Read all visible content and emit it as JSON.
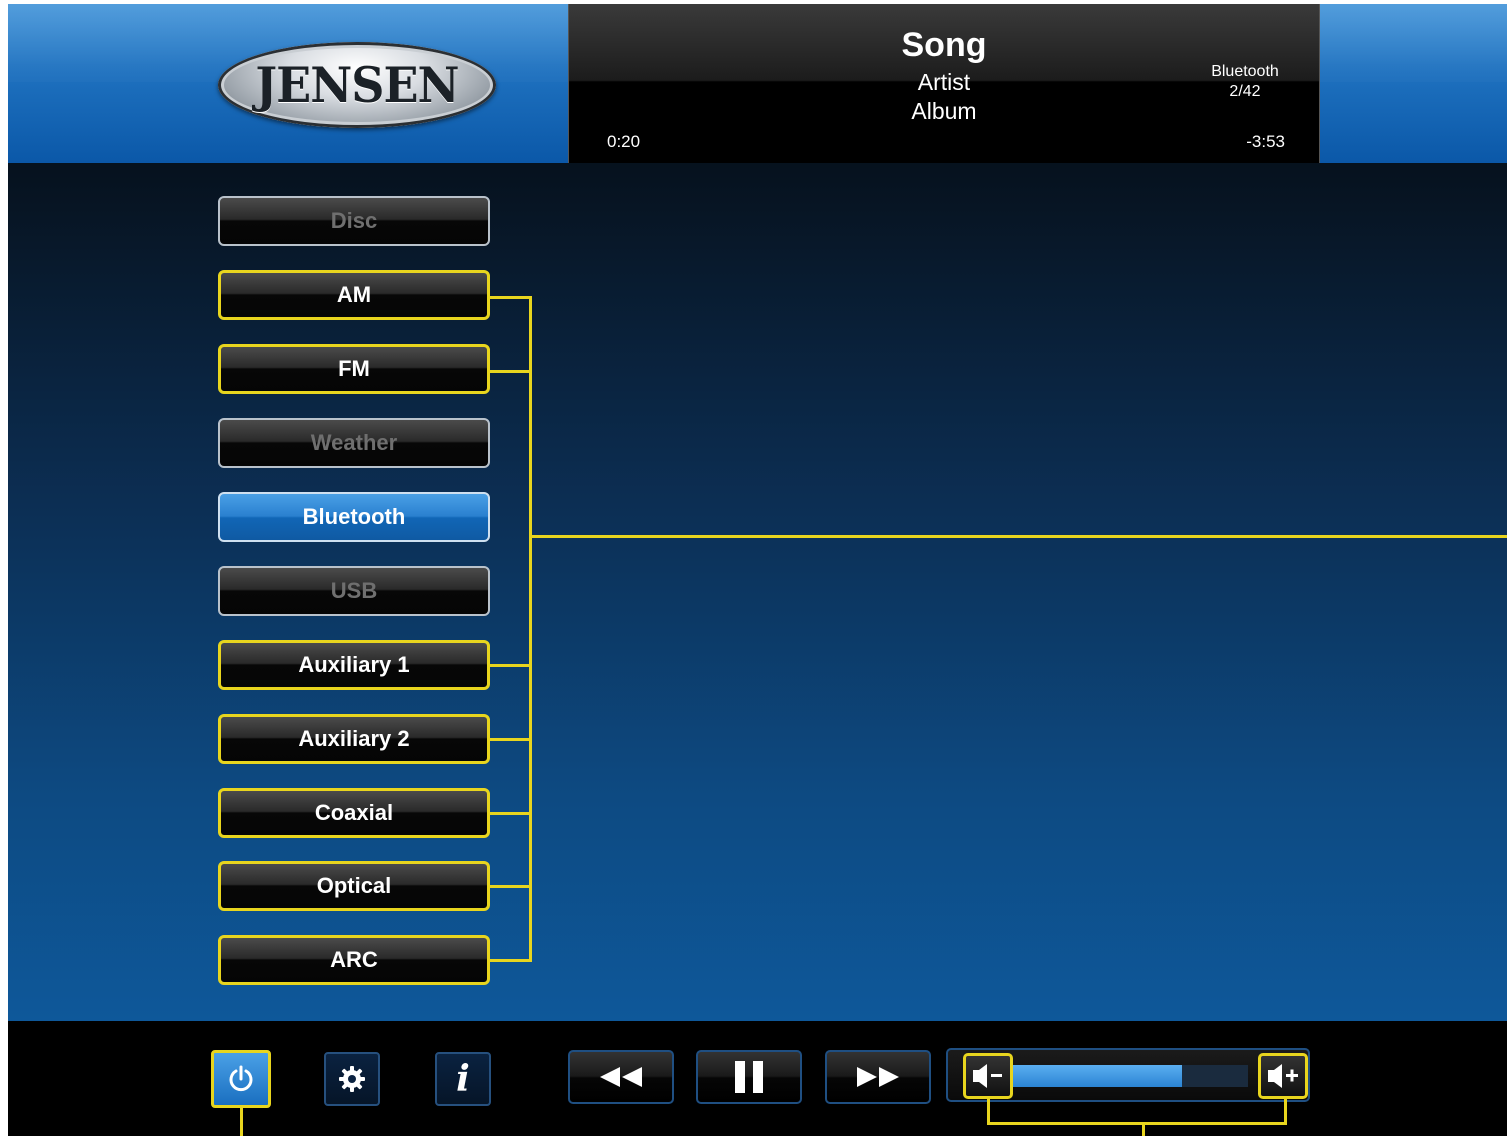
{
  "brand": {
    "logo_text": "JENSEN"
  },
  "now_playing": {
    "song": "Song",
    "artist": "Artist",
    "album": "Album",
    "source": "Bluetooth",
    "track": "2/42",
    "elapsed": "0:20",
    "remaining": "-3:53"
  },
  "sources": [
    {
      "label": "Disc",
      "state": "disabled"
    },
    {
      "label": "AM",
      "state": "highlighted"
    },
    {
      "label": "FM",
      "state": "highlighted"
    },
    {
      "label": "Weather",
      "state": "disabled"
    },
    {
      "label": "Bluetooth",
      "state": "active"
    },
    {
      "label": "USB",
      "state": "disabled"
    },
    {
      "label": "Auxiliary 1",
      "state": "highlighted"
    },
    {
      "label": "Auxiliary 2",
      "state": "highlighted"
    },
    {
      "label": "Coaxial",
      "state": "highlighted"
    },
    {
      "label": "Optical",
      "state": "highlighted"
    },
    {
      "label": "ARC",
      "state": "highlighted"
    }
  ],
  "controls": {
    "power_icon": "power-icon",
    "settings_icon": "gear-icon",
    "info_icon": "info-icon",
    "info_glyph": "i",
    "rewind_icon": "rewind-icon",
    "pause_icon": "pause-icon",
    "fast_forward_icon": "fast-forward-icon",
    "volume_down_icon": "volume-down-icon",
    "volume_up_icon": "volume-up-icon",
    "volume_level": 0.72
  },
  "colors": {
    "callout": "#e8d51e",
    "accent_blue": "#2a80cf",
    "header_blue": "#1f72c0"
  }
}
